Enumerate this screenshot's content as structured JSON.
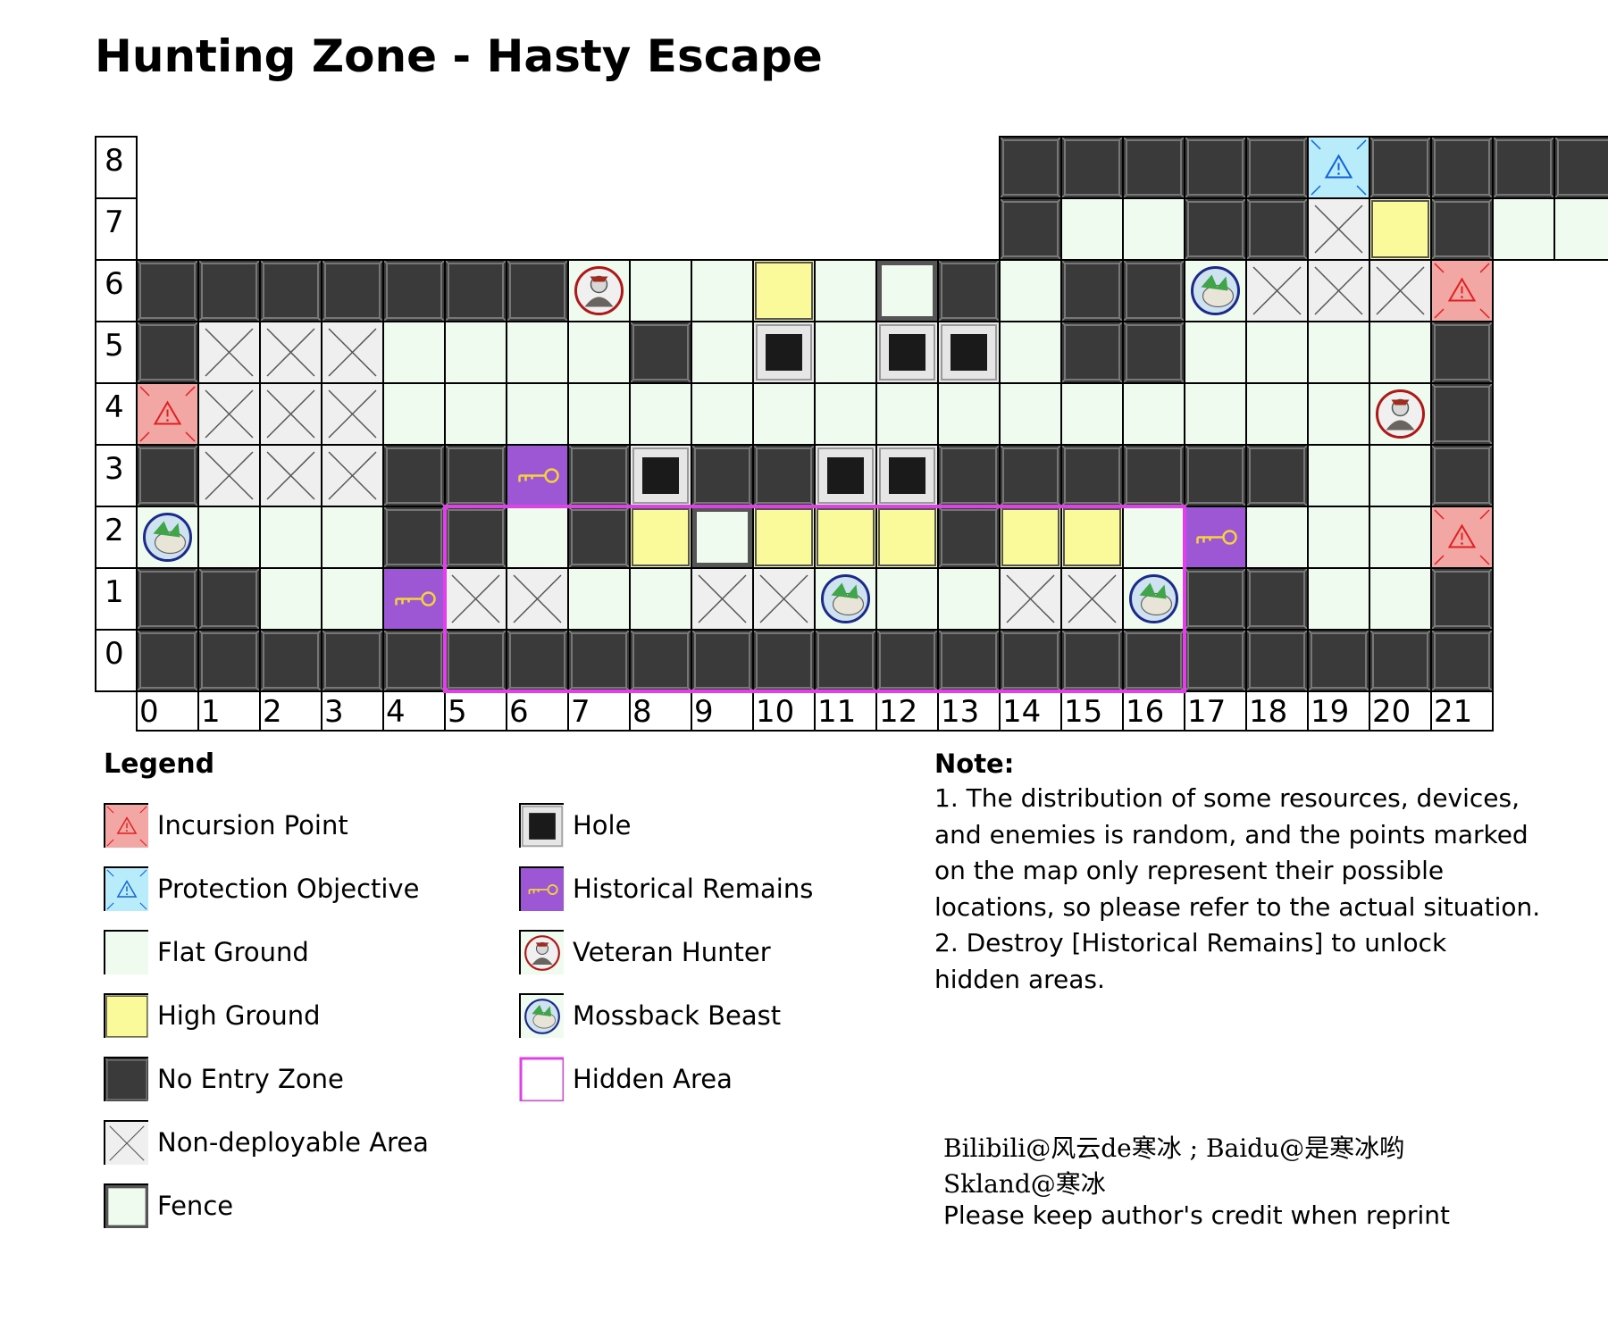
{
  "title": "Hunting Zone - Hasty Escape",
  "map": {
    "rows": [
      "              NNNNNPNNNNNNNNNN",
      "              NFFNNXHNFFFFXXXN",
      "NNNNNNNVFFHFENFNNMXXXI",
      "NXXXFFFFNFOFOOFNNFFFFN",
      "IXXXFFFFFFFFFFFFFFFFVN",
      "NXXXNNRNONNOONNNNNNFFN",
      "MFFFNNFNHEHHHNHHFRFFFI",
      "NNFFRXXFFXXMFFXXMNNFFN",
      "NNNNNNNNNNNNNNNNNNNNNN"
    ],
    "row_labels": [
      "8",
      "7",
      "6",
      "5",
      "4",
      "3",
      "2",
      "1",
      "0"
    ],
    "col_labels": [
      "0",
      "1",
      "2",
      "3",
      "4",
      "5",
      "6",
      "7",
      "8",
      "9",
      "10",
      "11",
      "12",
      "13",
      "14",
      "15",
      "16",
      "17",
      "18",
      "19",
      "20",
      "21"
    ],
    "hidden_area": {
      "col_from": 5,
      "col_to": 16,
      "row_from": 0,
      "row_to": 2
    },
    "colors": {
      "incursion": "#f2a7a4",
      "protection": "#b9ecfb",
      "flat": "#f0fbef",
      "high": "#fbfa9b",
      "noentry": "#3b3b3b",
      "nondeploy": "#efefef",
      "remains": "#9d56d4",
      "hole_bg": "#e6e6e6",
      "hole_core": "#1a1a1a",
      "hidden_border": "#e040e8",
      "key_color": "#f4d33c"
    }
  },
  "legend": {
    "title": "Legend",
    "left_items": [
      {
        "type": "incursion",
        "label": "Incursion Point"
      },
      {
        "type": "protection",
        "label": "Protection Objective"
      },
      {
        "type": "flat",
        "label": "Flat Ground"
      },
      {
        "type": "high",
        "label": "High Ground"
      },
      {
        "type": "noentry",
        "label": "No Entry Zone"
      },
      {
        "type": "nondeploy",
        "label": "Non-deployable Area"
      },
      {
        "type": "fence",
        "label": "Fence"
      }
    ],
    "right_items": [
      {
        "type": "hole",
        "label": "Hole"
      },
      {
        "type": "remains",
        "label": "Historical Remains"
      },
      {
        "type": "veteran",
        "label": "Veteran Hunter"
      },
      {
        "type": "mossback",
        "label": "Mossback Beast"
      },
      {
        "type": "hidden",
        "label": "Hidden Area"
      }
    ]
  },
  "note": {
    "title": "Note:",
    "lines": [
      "1. The distribution of some resources, devices,",
      "and enemies is random, and the points marked",
      "on the map only represent their possible",
      "locations, so please refer to the actual situation.",
      "2. Destroy [Historical Remains] to unlock",
      "hidden areas."
    ]
  },
  "credits": {
    "line1": "Bilibili@风云de寒冰 ; Baidu@是寒冰哟",
    "line2": "Skland@寒冰",
    "line3": "Please keep author's credit when reprint"
  }
}
